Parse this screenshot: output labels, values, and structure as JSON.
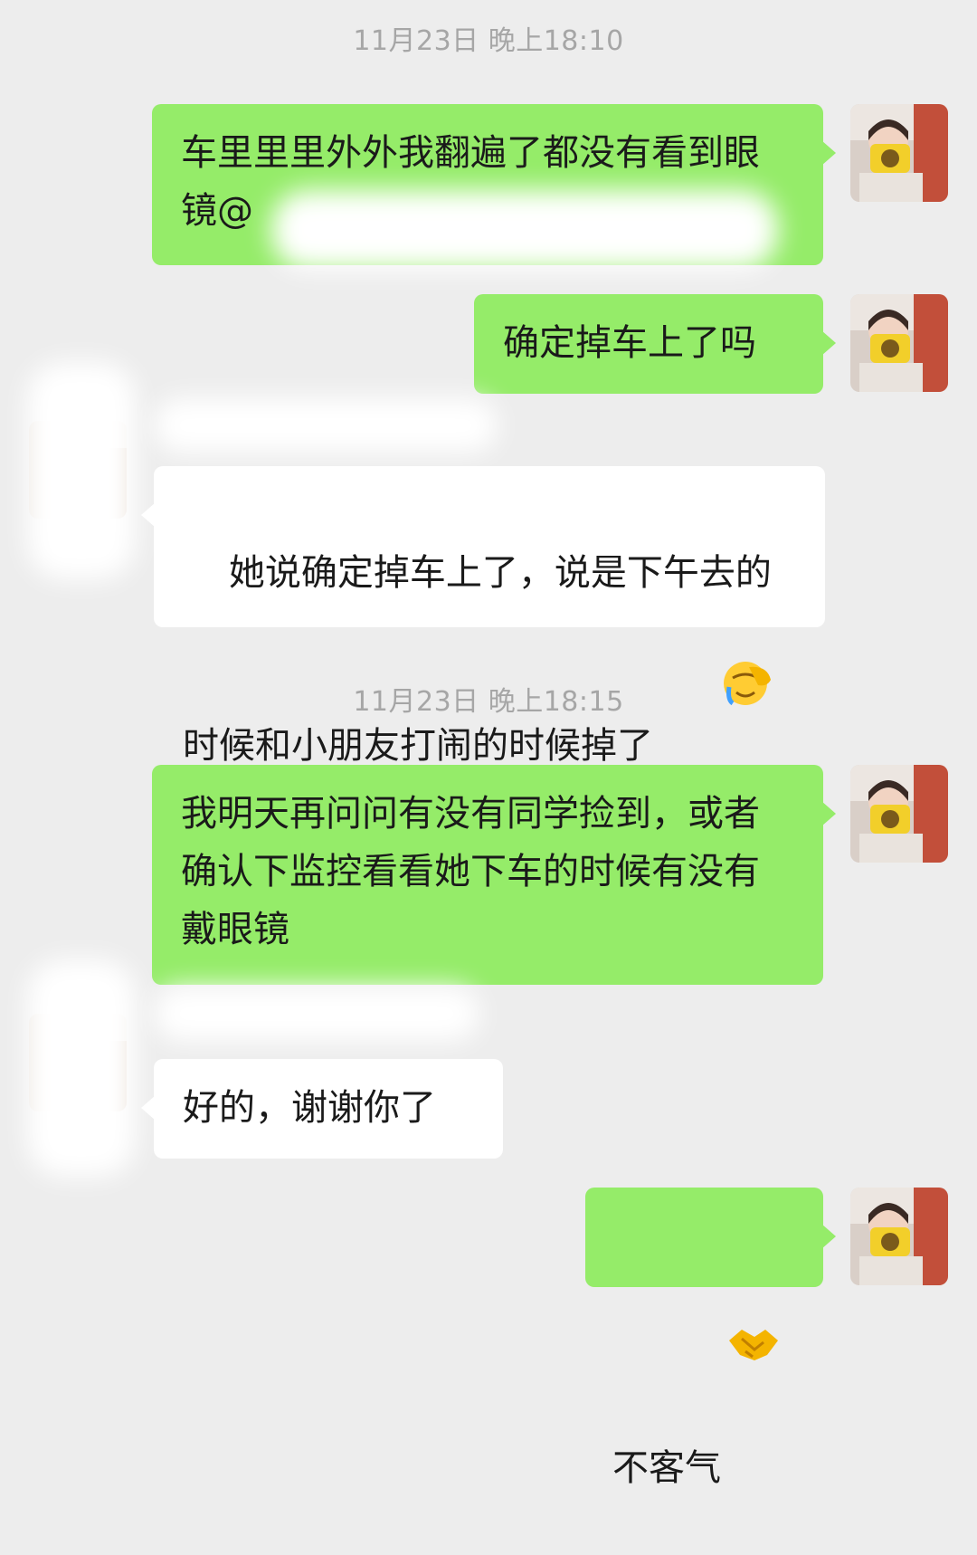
{
  "timestamps": [
    "11月23日 晚上18:10",
    "11月23日 晚上18:15"
  ],
  "messages": [
    {
      "sender": "me",
      "text": "车里里里外外我翻遍了都没有看到眼镜@"
    },
    {
      "sender": "me",
      "text": "确定掉车上了吗"
    },
    {
      "sender": "other",
      "text": "她说确定掉车上了，说是下午去的时候和小朋友打闹的时候掉了"
    },
    {
      "sender": "me",
      "text": "我明天再问问有没有同学捡到，或者确认下监控看看她下车的时候有没有戴眼镜"
    },
    {
      "sender": "other",
      "text": "好的，谢谢你了"
    },
    {
      "sender": "me",
      "text": "不客气"
    }
  ],
  "emoji": {
    "facepalm": "facepalm-crying-emoji",
    "handshake": "handshake-emoji"
  },
  "colors": {
    "background": "#ededed",
    "my_bubble": "#95ec69",
    "their_bubble": "#ffffff",
    "timestamp": "#a6a6a6"
  }
}
